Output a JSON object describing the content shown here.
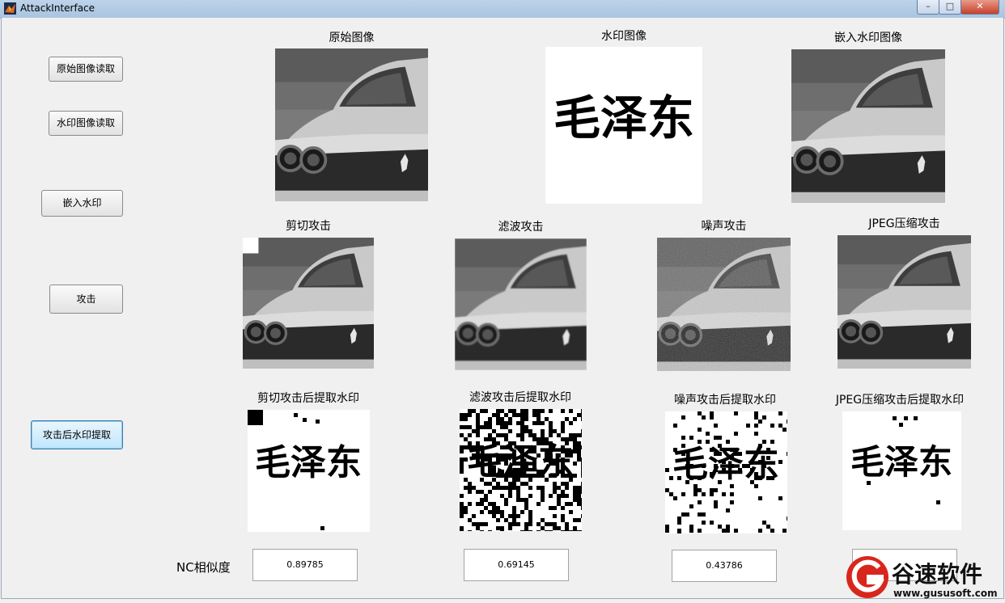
{
  "window": {
    "title": "AttackInterface",
    "controls": {
      "minimize": "–",
      "maximize": "□",
      "close": "✕"
    }
  },
  "buttons": {
    "read_original": "原始图像读取",
    "read_watermark": "水印图像读取",
    "embed": "嵌入水印",
    "attack": "攻击",
    "extract": "攻击后水印提取"
  },
  "captions": {
    "original": "原始图像",
    "watermark": "水印图像",
    "embedded": "嵌入水印图像",
    "crop": "剪切攻击",
    "filter": "滤波攻击",
    "noise": "噪声攻击",
    "jpeg": "JPEG压缩攻击",
    "crop_wm": "剪切攻击后提取水印",
    "filter_wm": "滤波攻击后提取水印",
    "noise_wm": "噪声攻击后提取水印",
    "jpeg_wm": "JPEG压缩攻击后提取水印"
  },
  "watermark_text": "毛泽东",
  "nc": {
    "label": "NC相似度",
    "values": [
      "0.89785",
      "0.69145",
      "0.43786",
      ""
    ]
  },
  "brand": {
    "name": "谷速软件",
    "url": "www.gususoft.com",
    "color": "#d9261c"
  }
}
